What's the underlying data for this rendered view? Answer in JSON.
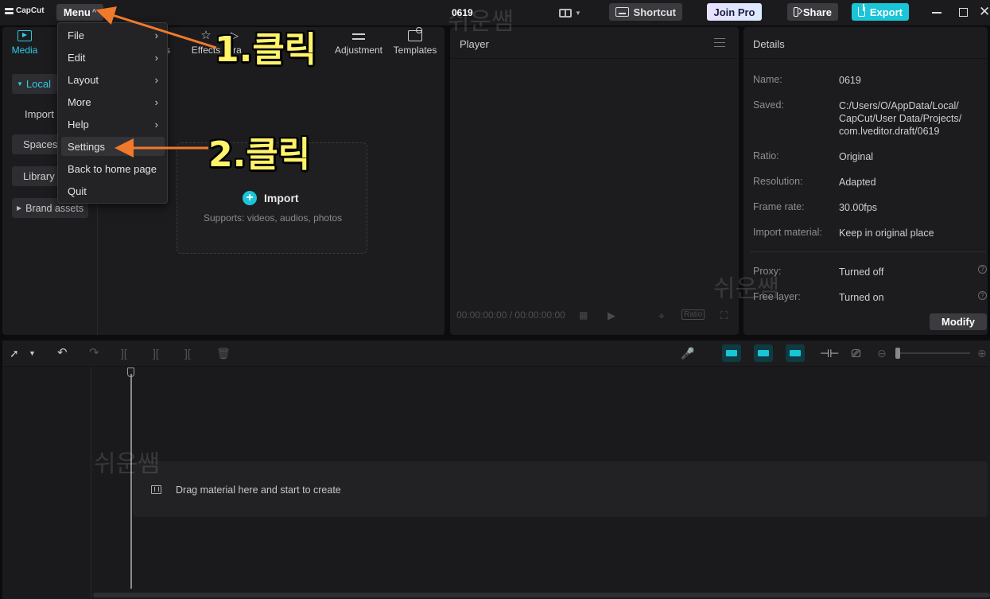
{
  "app": {
    "logo_text": "CapCut",
    "menu_label": "Menu",
    "project_name": "0619",
    "shortcut_label": "Shortcut",
    "join_pro_label": "Join Pro",
    "share_label": "Share",
    "export_label": "Export"
  },
  "menu": {
    "items": [
      {
        "label": "File",
        "submenu": true
      },
      {
        "label": "Edit",
        "submenu": true
      },
      {
        "label": "Layout",
        "submenu": true
      },
      {
        "label": "More",
        "submenu": true
      },
      {
        "label": "Help",
        "submenu": true
      },
      {
        "label": "Settings",
        "submenu": false,
        "highlighted": true
      },
      {
        "label": "Back to home page",
        "submenu": false
      },
      {
        "label": "Quit",
        "submenu": false
      }
    ]
  },
  "media_tabs": [
    {
      "label": "Media",
      "icon": "media-icon",
      "active": true
    },
    {
      "label": "rs",
      "icon": "filter-icon"
    },
    {
      "label": "Effects",
      "icon": "effects-icon"
    },
    {
      "label": "Tra",
      "icon": "transition-icon"
    },
    {
      "label": "Adjustment",
      "icon": "adjustment-icon"
    },
    {
      "label": "Templates",
      "icon": "templates-icon"
    }
  ],
  "sidebar": {
    "local": "Local",
    "import": "Import",
    "spaces": "Spaces",
    "library": "Library",
    "brand_assets": "Brand assets"
  },
  "import_area": {
    "button": "Import",
    "subtitle": "Supports: videos, audios, photos"
  },
  "player": {
    "title": "Player",
    "timecode": "00:00:00:00 / 00:00:00:00",
    "ratio_label": "Ratio"
  },
  "details": {
    "title": "Details",
    "rows": [
      {
        "label": "Name:",
        "value": "0619"
      },
      {
        "label": "Saved:",
        "value": "C:/Users/O/AppData/Local/ CapCut/User Data/Projects/ com.lveditor.draft/0619"
      },
      {
        "label": "Ratio:",
        "value": "Original"
      },
      {
        "label": "Resolution:",
        "value": "Adapted"
      },
      {
        "label": "Frame rate:",
        "value": "30.00fps"
      },
      {
        "label": "Import material:",
        "value": "Keep in original place"
      },
      {
        "label": "Proxy:",
        "value": "Turned off"
      },
      {
        "label": "Free layer:",
        "value": "Turned on"
      }
    ],
    "modify_label": "Modify"
  },
  "timeline": {
    "drop_text": "Drag material here and start to create"
  },
  "annotations": {
    "step1": "1.클릭",
    "step2": "2.클릭",
    "arrow_color": "#f07a2a"
  },
  "watermark": "쉬운쌤",
  "colors": {
    "accent": "#1ac5d7",
    "background": "#0c0c0e",
    "panel": "#1c1c1f"
  }
}
